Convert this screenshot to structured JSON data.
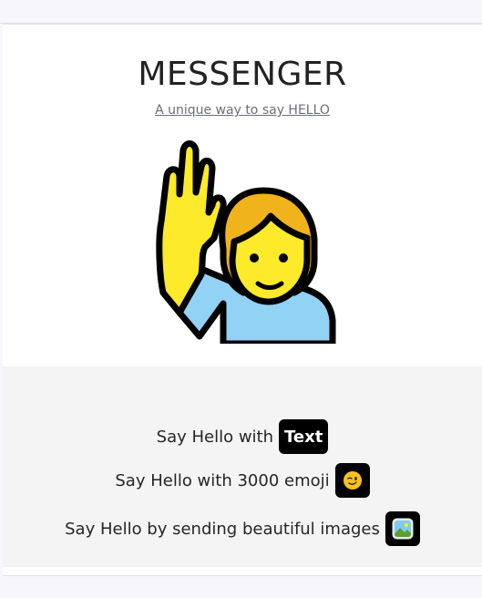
{
  "header": {
    "title": "MESSENGER",
    "tagline": "A unique way to say HELLO"
  },
  "hero": {
    "icon": "person-raising-hand-emoji"
  },
  "features": [
    {
      "label": "Say Hello with",
      "badge_text": "Text",
      "icon": "text-badge"
    },
    {
      "label": "Say Hello with 3000 emoji",
      "icon": "winking-face-emoji"
    },
    {
      "label": "Say Hello by sending beautiful images",
      "icon": "picture-icon"
    }
  ],
  "colors": {
    "card": "#ffffff",
    "features_bg": "#f4f4f4",
    "badge": "#000000",
    "skin": "#fcea2b",
    "hair": "#f1b31c",
    "shirt": "#92d3f5"
  }
}
